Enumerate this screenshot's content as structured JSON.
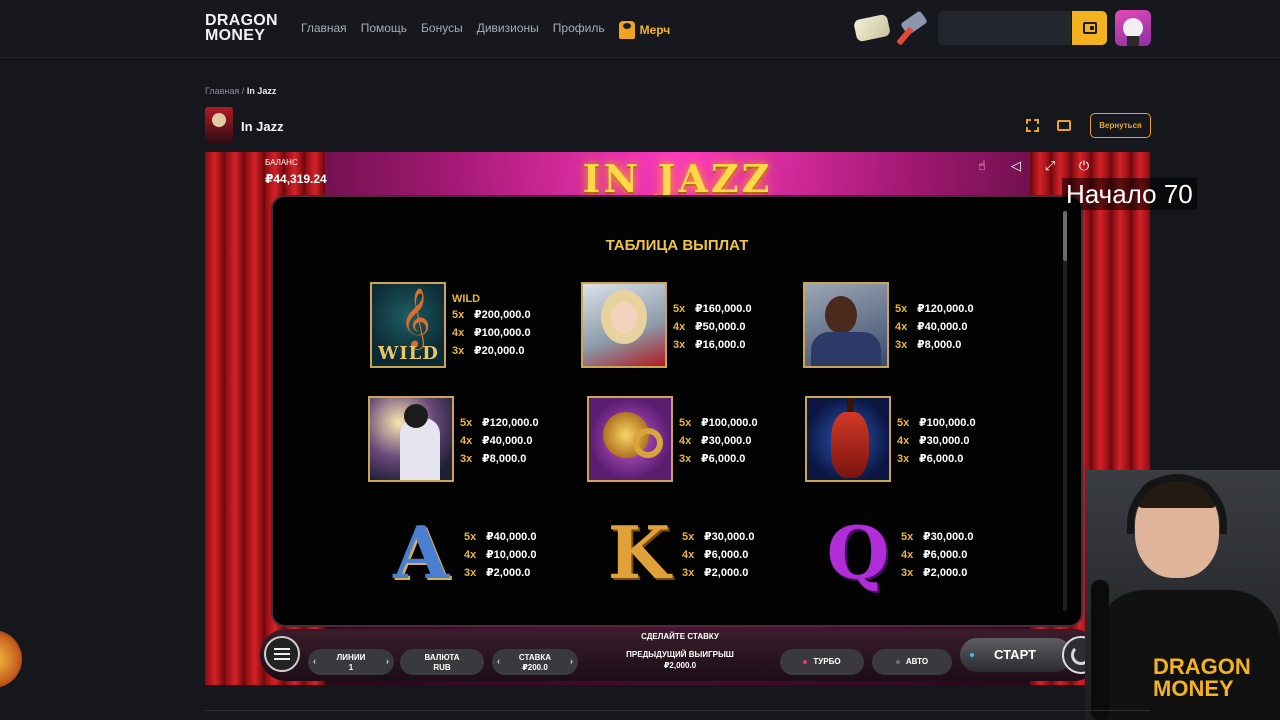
{
  "header": {
    "logo_line1": "DRAGON",
    "logo_line2": "MONEY",
    "nav": [
      "Главная",
      "Помощь",
      "Бонусы",
      "Дивизионы",
      "Профиль"
    ],
    "merch": "Мерч"
  },
  "breadcrumb": {
    "home": "Главная",
    "separator": "/",
    "current": "In Jazz"
  },
  "page": {
    "title": "In Jazz",
    "back_button": "Вернуться"
  },
  "game": {
    "balance_label": "БАЛАНС",
    "balance_value": "₽44,319.24",
    "logo": "IN JAZZ",
    "paytable_title": "ТАБЛИЦА ВЫПЛАТ",
    "wild_label": "WILD",
    "wild_word": "WILD",
    "symbols": [
      {
        "icon": "wild-clef",
        "pays": [
          "₽200,000.0",
          "₽100,000.0",
          "₽20,000.0"
        ]
      },
      {
        "icon": "singer-lady",
        "pays": [
          "₽160,000.0",
          "₽50,000.0",
          "₽16,000.0"
        ]
      },
      {
        "icon": "bass-player",
        "pays": [
          "₽120,000.0",
          "₽40,000.0",
          "₽8,000.0"
        ]
      },
      {
        "icon": "sax-player",
        "pays": [
          "₽120,000.0",
          "₽40,000.0",
          "₽8,000.0"
        ]
      },
      {
        "icon": "french-horn",
        "pays": [
          "₽100,000.0",
          "₽30,000.0",
          "₽6,000.0"
        ]
      },
      {
        "icon": "cello",
        "pays": [
          "₽100,000.0",
          "₽30,000.0",
          "₽6,000.0"
        ]
      },
      {
        "icon": "letter-a",
        "letter": "A",
        "pays": [
          "₽40,000.0",
          "₽10,000.0",
          "₽2,000.0"
        ]
      },
      {
        "icon": "letter-k",
        "letter": "K",
        "pays": [
          "₽30,000.0",
          "₽6,000.0",
          "₽2,000.0"
        ]
      },
      {
        "icon": "letter-q",
        "letter": "Q",
        "pays": [
          "₽30,000.0",
          "₽6,000.0",
          "₽2,000.0"
        ]
      }
    ],
    "multipliers": [
      "5x",
      "4x",
      "3x"
    ],
    "controls": {
      "place_bet": "СДЕЛАЙТЕ СТАВКУ",
      "lines_label": "ЛИНИИ",
      "lines_value": "1",
      "currency_label": "ВАЛЮТА",
      "currency_value": "RUB",
      "bet_label": "СТАВКА",
      "bet_value": "₽200.0",
      "prev_win_label": "ПРЕДЫДУЩИЙ ВЫИГРЫШ",
      "prev_win_value": "₽2,000.0",
      "turbo": "ТУРБО",
      "auto": "АВТО",
      "start": "СТАРТ"
    }
  },
  "overlay": {
    "text": "Начало 70"
  },
  "streamer": {
    "shirt_line1": "DRAGON",
    "shirt_line2": "MONEY"
  },
  "colors": {
    "accent": "#f3b21e",
    "pay_multiplier": "#e8b53e",
    "paytable_title": "#f2c443"
  }
}
